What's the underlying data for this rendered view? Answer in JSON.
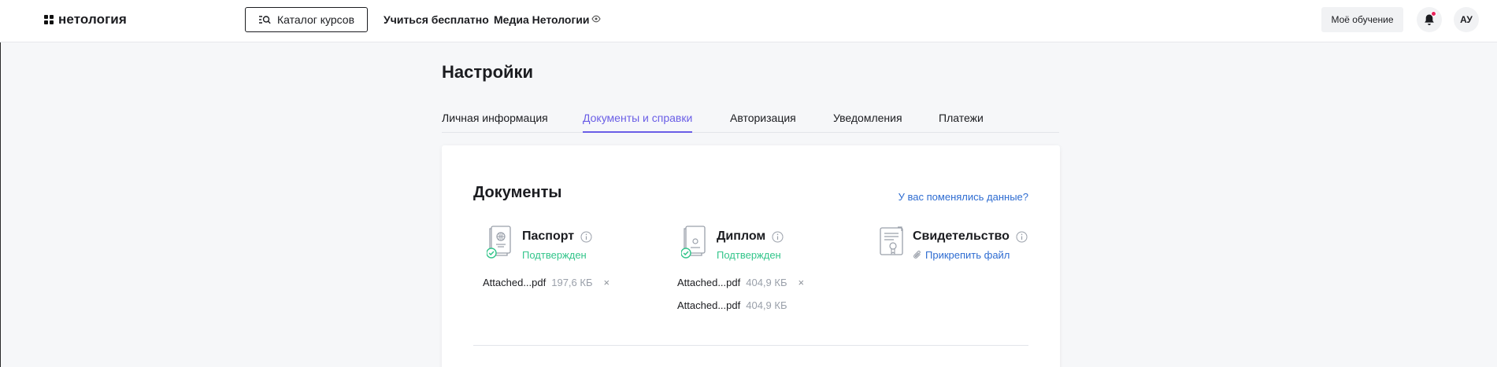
{
  "header": {
    "logo_text": "нетология",
    "catalog_label": "Каталог курсов",
    "nav": [
      "Учиться бесплатно",
      "Медиа Нетологии"
    ],
    "my_learning_label": "Моё обучение",
    "avatar_initials": "АУ",
    "notification_dot_color": "#e9245c"
  },
  "settings": {
    "title": "Настройки",
    "tabs": [
      {
        "label": "Личная информация",
        "active": false
      },
      {
        "label": "Документы и справки",
        "active": true
      },
      {
        "label": "Авторизация",
        "active": false
      },
      {
        "label": "Уведомления",
        "active": false
      },
      {
        "label": "Платежи",
        "active": false
      }
    ],
    "accent_color": "#6a5ee6"
  },
  "documents": {
    "title": "Документы",
    "changed_link": "У вас поменялись данные?",
    "items": [
      {
        "name": "Паспорт",
        "icon": "passport-icon",
        "status": "Подтвержден",
        "files": [
          {
            "name": "Attached...pdf",
            "size": "197,6 КБ",
            "removable": true
          }
        ]
      },
      {
        "name": "Диплом",
        "icon": "diploma-icon",
        "status": "Подтвержден",
        "files": [
          {
            "name": "Attached...pdf",
            "size": "404,9 КБ",
            "removable": true
          },
          {
            "name": "Attached...pdf",
            "size": "404,9 КБ",
            "removable": false
          }
        ]
      },
      {
        "name": "Свидетельство",
        "icon": "certificate-icon",
        "attach_label": "Прикрепить файл",
        "files": []
      }
    ],
    "status_color": "#33c58b",
    "link_color": "#2e6cd1",
    "remove_glyph": "×"
  }
}
